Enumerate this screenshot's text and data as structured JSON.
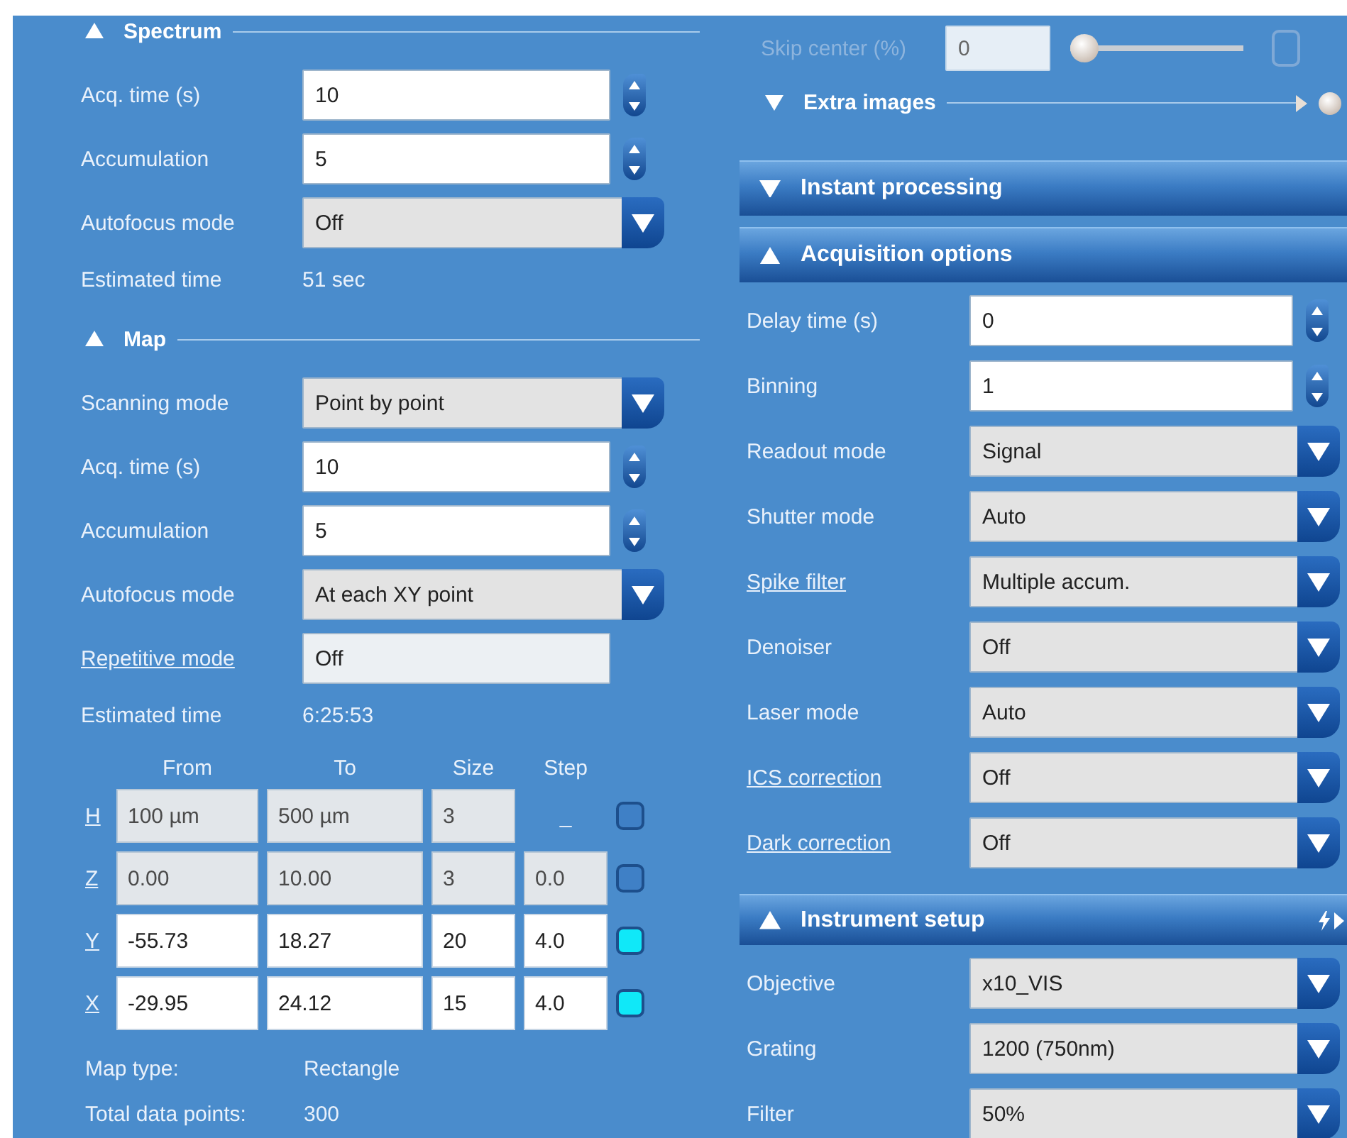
{
  "left": {
    "sections": [
      {
        "title": "Spectrum",
        "expanded": true,
        "rows": [
          {
            "kind": "spin",
            "label": "Acq. time (s)",
            "value": "10"
          },
          {
            "kind": "spin",
            "label": "Accumulation",
            "value": "5"
          },
          {
            "kind": "dropdown",
            "label": "Autofocus mode",
            "value": "Off"
          },
          {
            "kind": "info",
            "label": "Estimated time",
            "value": "51 sec"
          }
        ]
      },
      {
        "title": "Map",
        "expanded": true,
        "rows": [
          {
            "kind": "dropdown",
            "label": "Scanning mode",
            "value": "Point by point"
          },
          {
            "kind": "spin",
            "label": "Acq. time (s)",
            "value": "10"
          },
          {
            "kind": "spin",
            "label": "Accumulation",
            "value": "5"
          },
          {
            "kind": "dropdown",
            "label": "Autofocus mode",
            "value": "At each XY point"
          },
          {
            "kind": "readonly",
            "label": "Repetitive mode",
            "link": true,
            "value": "Off"
          },
          {
            "kind": "info",
            "label": "Estimated time",
            "value": "6:25:53"
          }
        ],
        "grid": {
          "columns": [
            "From",
            "To",
            "Size",
            "Step"
          ],
          "rows": [
            {
              "axis": "H",
              "disabled": true,
              "checked": false,
              "cells": [
                {
                  "value": "100 µm"
                },
                {
                  "value": "500 µm"
                },
                {
                  "value": "3"
                },
                {
                  "value": "_",
                  "boxed": false
                }
              ]
            },
            {
              "axis": "Z",
              "disabled": true,
              "checked": false,
              "cells": [
                {
                  "value": "0.00"
                },
                {
                  "value": "10.00"
                },
                {
                  "value": "3"
                },
                {
                  "value": "0.0"
                }
              ]
            },
            {
              "axis": "Y",
              "disabled": false,
              "checked": true,
              "cells": [
                {
                  "value": "-55.73"
                },
                {
                  "value": "18.27"
                },
                {
                  "value": "20"
                },
                {
                  "value": "4.0"
                }
              ]
            },
            {
              "axis": "X",
              "disabled": false,
              "checked": true,
              "cells": [
                {
                  "value": "-29.95"
                },
                {
                  "value": "24.12"
                },
                {
                  "value": "15"
                },
                {
                  "value": "4.0"
                }
              ]
            }
          ]
        },
        "summary": [
          {
            "label": "Map type:",
            "value": "Rectangle"
          },
          {
            "label": "Total data points:",
            "value": "300"
          }
        ]
      }
    ]
  },
  "right": {
    "skip_center": {
      "label": "Skip center (%)",
      "value": "0",
      "disabled": true,
      "slider": {
        "level": 0
      },
      "checked": false
    },
    "extra_images": {
      "title": "Extra images",
      "expanded": false
    },
    "panels": [
      {
        "title": "Instant processing",
        "expanded": false
      },
      {
        "title": "Acquisition options",
        "expanded": true,
        "rows": [
          {
            "kind": "spin",
            "label": "Delay time (s)",
            "value": "0"
          },
          {
            "kind": "spin",
            "label": "Binning",
            "value": "1"
          },
          {
            "kind": "dropdown",
            "label": "Readout mode",
            "value": "Signal"
          },
          {
            "kind": "dropdown",
            "label": "Shutter mode",
            "value": "Auto"
          },
          {
            "kind": "dropdown",
            "label": "Spike filter",
            "link": true,
            "value": "Multiple accum."
          },
          {
            "kind": "dropdown",
            "label": "Denoiser",
            "value": "Off"
          },
          {
            "kind": "dropdown",
            "label": "Laser mode",
            "value": "Auto"
          },
          {
            "kind": "dropdown",
            "label": "ICS correction",
            "link": true,
            "value": "Off"
          },
          {
            "kind": "dropdown",
            "label": "Dark correction",
            "link": true,
            "value": "Off"
          }
        ]
      },
      {
        "title": "Instrument setup",
        "expanded": true,
        "rows": [
          {
            "kind": "dropdown",
            "label": "Objective",
            "value": "x10_VIS"
          },
          {
            "kind": "dropdown",
            "label": "Grating",
            "value": "1200 (750nm)"
          },
          {
            "kind": "dropdown",
            "label": "Filter",
            "value": "50%"
          }
        ]
      }
    ]
  }
}
